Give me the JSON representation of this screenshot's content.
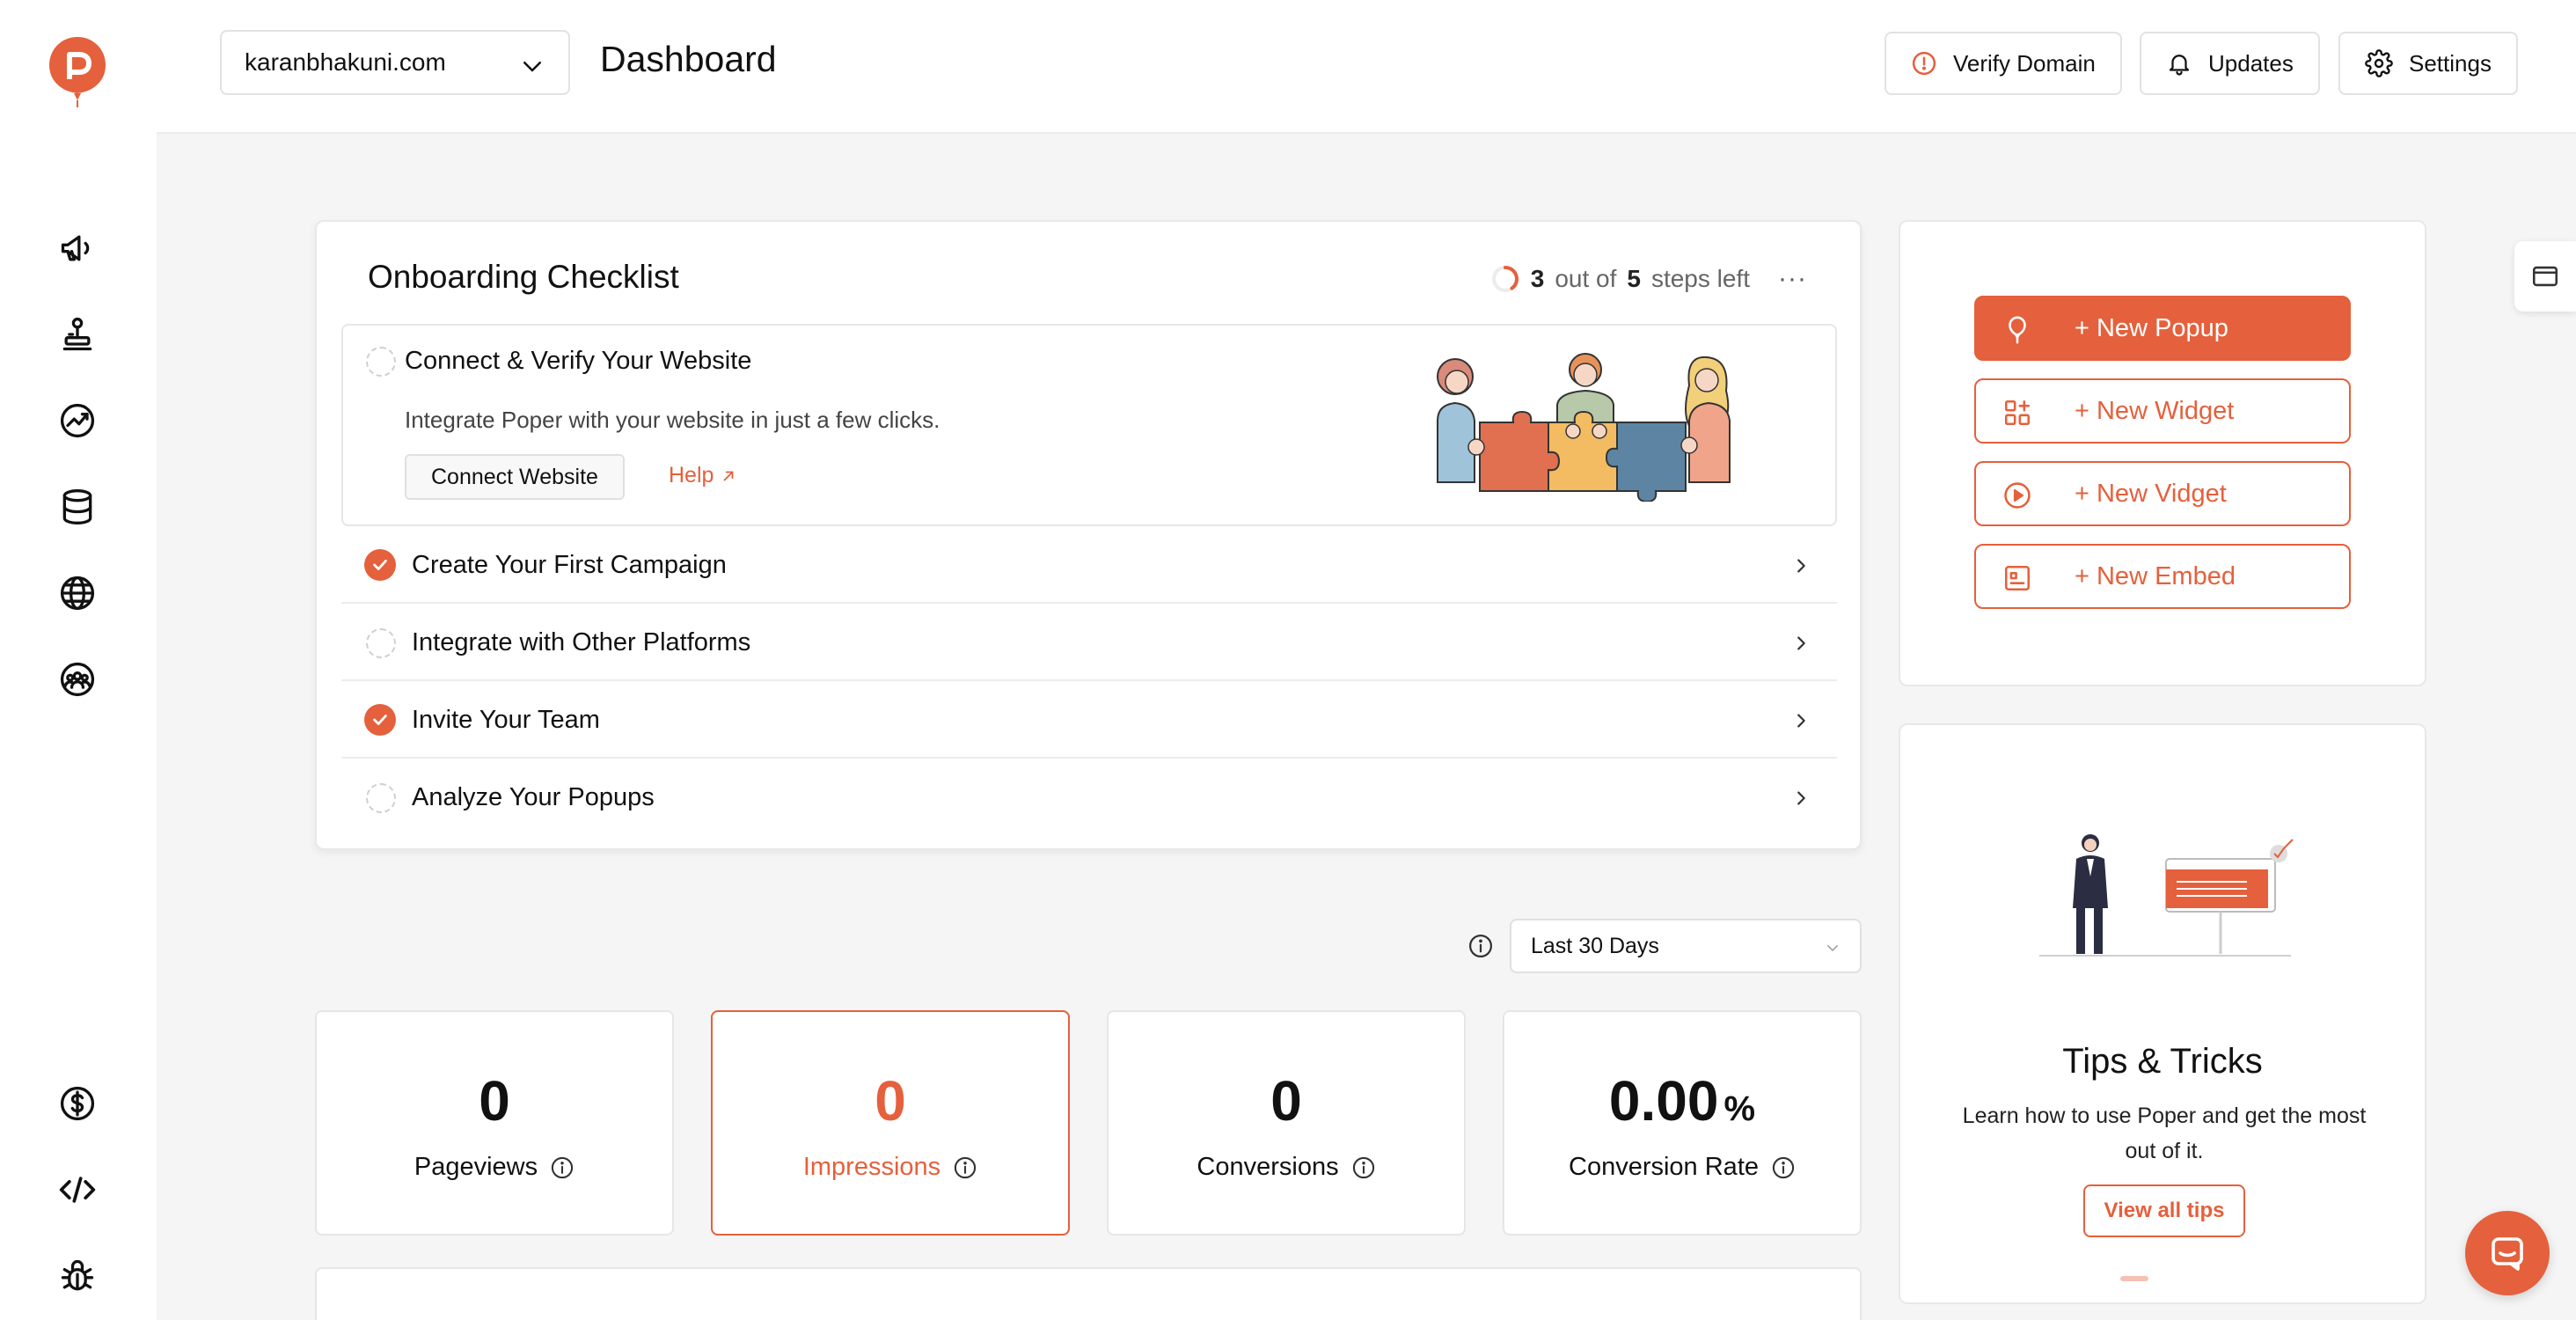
{
  "header": {
    "domain": "karanbhakuni.com",
    "title": "Dashboard",
    "verify_label": "Verify Domain",
    "updates_label": "Updates",
    "settings_label": "Settings"
  },
  "sidebar": {
    "icons": [
      "megaphone-icon",
      "joystick-icon",
      "trend-chart-icon",
      "database-icon",
      "globe-icon",
      "team-icon",
      "dollar-icon",
      "code-icon",
      "bug-icon"
    ]
  },
  "onboarding": {
    "title": "Onboarding Checklist",
    "progress": {
      "remaining": "3",
      "out_of": "out of",
      "total": "5",
      "suffix": "steps left",
      "fraction_done": 0.4
    },
    "open_step": {
      "title": "Connect & Verify Your Website",
      "description": "Integrate Poper with your website in just a few clicks.",
      "button_label": "Connect Website",
      "help_label": "Help"
    },
    "steps": [
      {
        "title": "Create Your First Campaign",
        "done": true
      },
      {
        "title": "Integrate with Other Platforms",
        "done": false
      },
      {
        "title": "Invite Your Team",
        "done": true
      },
      {
        "title": "Analyze Your Popups",
        "done": false
      }
    ]
  },
  "actions": [
    {
      "label": "+ New Popup",
      "icon": "balloon-icon",
      "primary": true
    },
    {
      "label": "+ New Widget",
      "icon": "widget-icon",
      "primary": false
    },
    {
      "label": "+ New Vidget",
      "icon": "play-icon",
      "primary": false
    },
    {
      "label": "+ New Embed",
      "icon": "embed-icon",
      "primary": false
    }
  ],
  "tips": {
    "title": "Tips & Tricks",
    "description": "Learn how to use Poper and get the most out of it.",
    "button_label": "View all tips"
  },
  "filter": {
    "selected": "Last 30 Days"
  },
  "stats": [
    {
      "value": "0",
      "suffix": "",
      "label": "Pageviews",
      "active": false
    },
    {
      "value": "0",
      "suffix": "",
      "label": "Impressions",
      "active": true
    },
    {
      "value": "0",
      "suffix": "",
      "label": "Conversions",
      "active": false
    },
    {
      "value": "0.00",
      "suffix": "%",
      "label": "Conversion Rate",
      "active": false
    }
  ],
  "colors": {
    "accent": "#e5603c",
    "background": "#f5f5f5",
    "border": "#e6e6e6"
  }
}
